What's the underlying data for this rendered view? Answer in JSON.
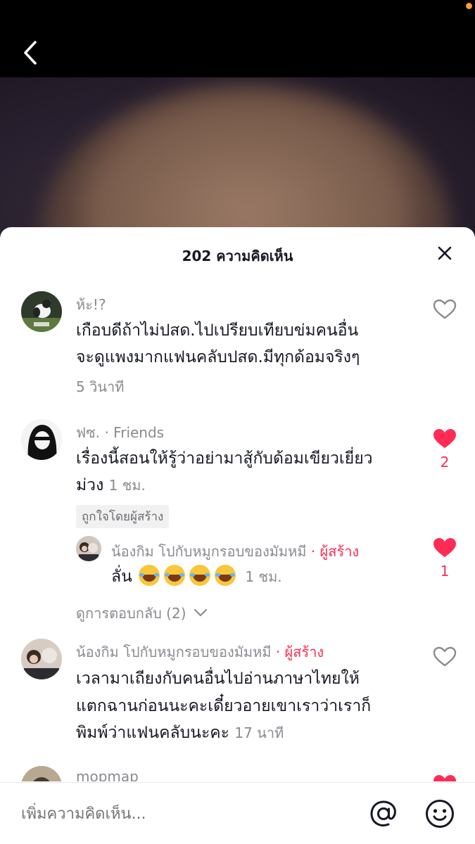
{
  "header": {
    "title": "202 ความคิดเห็น"
  },
  "comments": [
    {
      "username": "ห้ะ!?",
      "lines": [
        "เกือบดีถ้าไม่ปสด.ไปเปรียบเทียบข่มคนอื่น",
        "จะดูแพงมากแฟนคลับปสด.มีทุกด้อมจริงๆ"
      ],
      "time": "5 วินาที",
      "liked": false
    },
    {
      "username": "ฟซ.",
      "tag": "· Friends",
      "lines": [
        "เรื่องนี้สอนให้รู้ว่าอย่ามาสู้กับด้อมเขียวเยี่ยว",
        "ม่วง"
      ],
      "time": "1 ชม.",
      "liked_by_creator": "ถูกใจโดยผู้สร้าง",
      "liked": true,
      "like_count": "2",
      "reply": {
        "username": "น้องกิม โปกับหมูกรอบของมัมหมี",
        "creator_tag": "· ผู้สร้าง",
        "text": "ลั่น",
        "emojis": [
          "face-with-tears-of-joy",
          "face-with-tears-of-joy",
          "face-with-tears-of-joy",
          "face-with-tears-of-joy"
        ],
        "time": "1 ชม.",
        "liked": true,
        "like_count": "1"
      },
      "view_replies": "ดูการตอบกลับ (2)"
    },
    {
      "username": "น้องกิม โปกับหมูกรอบของมัมหมี",
      "creator_tag": "· ผู้สร้าง",
      "lines": [
        "เวลามาเถียงกับคนอื่นไปอ่านภาษาไทยให้",
        "แตกฉานก่อนนะคะเดี๋ยวอายเขาเราว่าเราก็",
        "พิมพ์ว่าแฟนคลับนะคะ"
      ],
      "time": "17 นาที",
      "liked": false
    },
    {
      "username": "mopmap",
      "liked": true
    }
  ],
  "input": {
    "placeholder": "เพิ่มความคิดเห็น..."
  },
  "colors": {
    "accent": "#fe2c55",
    "text": "#161823",
    "muted": "#8a8b91"
  }
}
